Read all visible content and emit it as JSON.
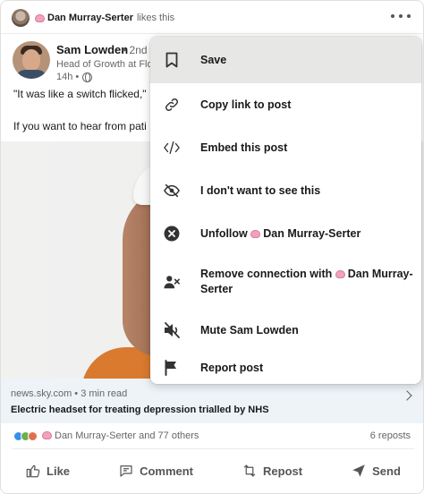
{
  "feed_header": {
    "actor_name": "Dan Murray-Serter",
    "action_text": "likes this"
  },
  "post": {
    "author_name": "Sam Lowden",
    "author_degree": "• 2nd",
    "author_headline": "Head of Growth at Flo",
    "time_ago": "14h •",
    "text_line_1": "\"It was like a switch flicked,\"",
    "text_line_2": "If you want to hear from pati"
  },
  "link_preview": {
    "source": "news.sky.com • 3 min read",
    "title": "Electric headset for treating depression trialled by NHS"
  },
  "social_counts": {
    "reactions_text": "Dan Murray-Serter and 77 others",
    "reposts_text": "6 reposts"
  },
  "actions": {
    "like": "Like",
    "comment": "Comment",
    "repost": "Repost",
    "send": "Send"
  },
  "menu": {
    "save": "Save",
    "copy_link": "Copy link to post",
    "embed": "Embed this post",
    "hide": "I don't want to see this",
    "unfollow_prefix": "Unfollow",
    "unfollow_name": "Dan Murray-Serter",
    "remove_prefix": "Remove connection with",
    "remove_name_line1": "Dan Murray-",
    "remove_name_line2": "Serter",
    "mute": "Mute Sam Lowden",
    "report": "Report post"
  },
  "icons": {
    "more": "more-icon",
    "globe": "globe-icon",
    "bookmark": "bookmark-icon",
    "link": "link-icon",
    "embed": "code-icon",
    "hide": "eye-slash-icon",
    "unfollow": "close-circle-icon",
    "remove_connection": "person-remove-icon",
    "mute": "speaker-mute-icon",
    "report": "flag-icon"
  },
  "colors": {
    "link_bar": "#eef3f8",
    "menu_hover": "#e7e7e6",
    "reaction_like": "#378fe9",
    "reaction_celebrate": "#6dae4f",
    "reaction_love": "#df704d"
  }
}
